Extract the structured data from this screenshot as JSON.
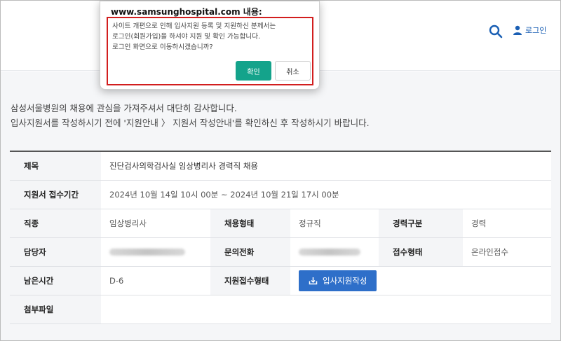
{
  "header": {
    "login_label": "로그인"
  },
  "intro": {
    "line1": "삼성서울병원의 채용에 관심을 가져주셔서 대단히 감사합니다.",
    "line2": "입사지원서를 작성하시기 전에 '지원안내 〉 지원서 작성안내'를 확인하신 후 작성하시기 바랍니다."
  },
  "job": {
    "title_label": "제목",
    "title_value": "진단검사의학검사실 임상병리사 경력직 채용",
    "period_label": "지원서 접수기간",
    "period_value": "2024년 10월 14일 10시 00분 ~ 2024년 10월 21일 17시 00분",
    "occupation_label": "직종",
    "occupation_value": "임상병리사",
    "employment_label": "채용형태",
    "employment_value": "정규직",
    "career_label": "경력구분",
    "career_value": "경력",
    "manager_label": "담당자",
    "contact_label": "문의전화",
    "receipt_label": "접수형태",
    "receipt_value": "온라인접수",
    "remaining_label": "남은시간",
    "remaining_value": "D-6",
    "apply_type_label": "지원접수형태",
    "apply_button": "입사지원작성",
    "attachment_label": "첨부파일"
  },
  "dialog": {
    "title": "www.samsunghospital.com 내용:",
    "line1": "사이트 개편으로 인해 입사지원 등록 및 지원하신 분께서는",
    "line2": "로그인(회원가입)을 하셔야 지원 및 확인 가능합니다.",
    "line3": "로그인 화면으로 이동하시겠습니까?",
    "ok_label": "확인",
    "cancel_label": "취소"
  },
  "colors": {
    "accent_blue": "#2e6fc9",
    "ok_green": "#14a38b",
    "highlight_red": "#d21e1e"
  },
  "icons": {
    "search": "search-icon",
    "user": "user-icon",
    "upload": "upload-icon"
  }
}
